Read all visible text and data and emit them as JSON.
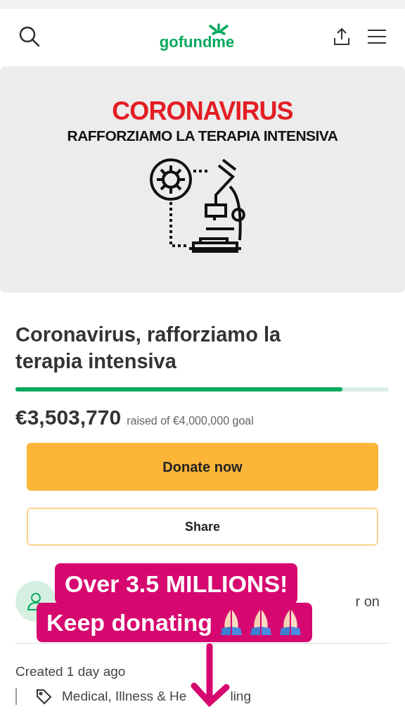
{
  "header": {
    "logo": "gofundme"
  },
  "banner": {
    "headline": "CORONAVIRUS",
    "subline": "RAFFORZIAMO LA TERAPIA INTENSIVA"
  },
  "campaign": {
    "title": "Coronavirus, rafforziamo la terapia intensiva",
    "level": 0.876,
    "raised": "€3,503,770",
    "goal_text": "raised of €4,000,000 goal"
  },
  "buttons": [
    {
      "kind": "primary",
      "label": "Donate now"
    },
    {
      "kind": "outline",
      "label": "Share"
    }
  ],
  "organizer": {
    "text_fragment": "r on"
  },
  "details": {
    "created": "Created 1 day ago",
    "category_parts": [
      "Medical, Illness & He",
      "ling"
    ]
  },
  "sticker": {
    "lines": [
      "Over 3.5 MILLIONS!",
      "Keep donating"
    ]
  }
}
